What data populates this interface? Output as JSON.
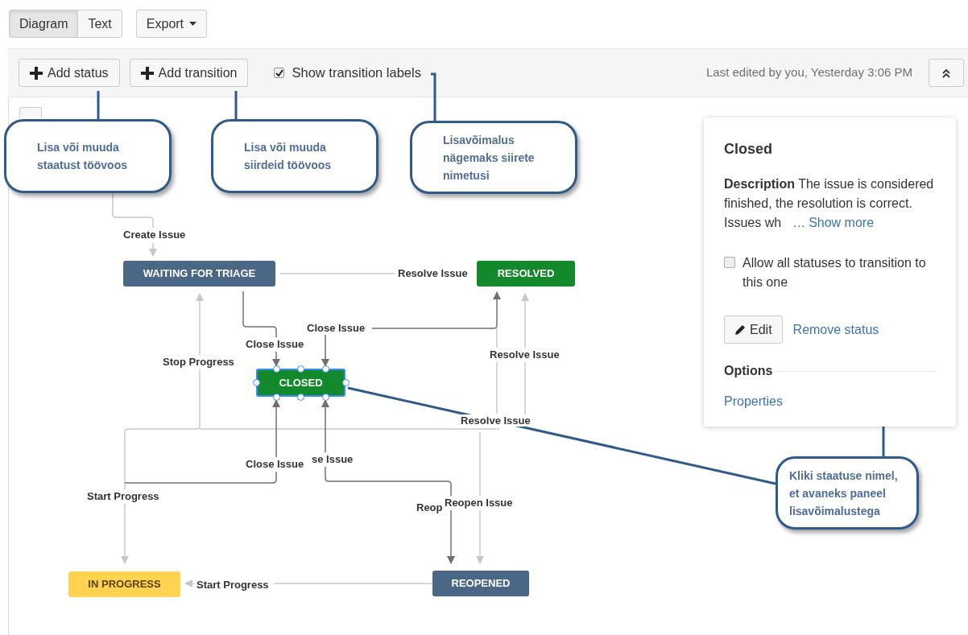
{
  "view_tabs": [
    {
      "label": "Diagram",
      "selected": true
    },
    {
      "label": "Text",
      "selected": false
    }
  ],
  "export_button": {
    "label": "Export"
  },
  "toolbar": {
    "buttons": [
      "Add status",
      "Add transition"
    ],
    "show_labels": {
      "label": "Show transition labels",
      "checked": true
    },
    "last_edited": "Last edited by you, Yesterday 3:06 PM"
  },
  "diagram": {
    "statuses": [
      {
        "name": "WAITING FOR TRIAGE",
        "color": "#4a6785",
        "selected": false
      },
      {
        "name": "RESOLVED",
        "color": "#14892c",
        "selected": false
      },
      {
        "name": "CLOSED",
        "color": "#14892c",
        "selected": true
      },
      {
        "name": "IN PROGRESS",
        "color": "#ffd351",
        "selected": false
      },
      {
        "name": "REOPENED",
        "color": "#4a6785",
        "selected": false
      }
    ],
    "transition_labels": [
      "Create Issue",
      "Resolve Issue",
      "Close Issue",
      "Close Issue",
      "Stop Progress",
      "Resolve Issue",
      "Resolve Issue",
      "Close Issue",
      "se Issue",
      "Start Progress",
      "Reop",
      "Reopen Issue",
      "Start Progress"
    ]
  },
  "callouts": [
    "Lisa või muuda staatust töövoos",
    "Lisa või muuda siirdeid töövoos",
    "Lisavõimalus nägemaks siirete nimetusi",
    "Kliki staatuse nimel, et avaneks paneel lisavõimalustega"
  ],
  "panel": {
    "title": "Closed",
    "description": "**Description** The issue is considered finished, the resolution is correct. Issues wh",
    "ellipsis": "…",
    "show_more": "Show more",
    "allow_all": {
      "label": "Allow all statuses to transition to this one",
      "checked": false
    },
    "edit_button": "Edit",
    "remove_link": "Remove status",
    "options_heading": "Options",
    "properties_link": "Properties"
  }
}
